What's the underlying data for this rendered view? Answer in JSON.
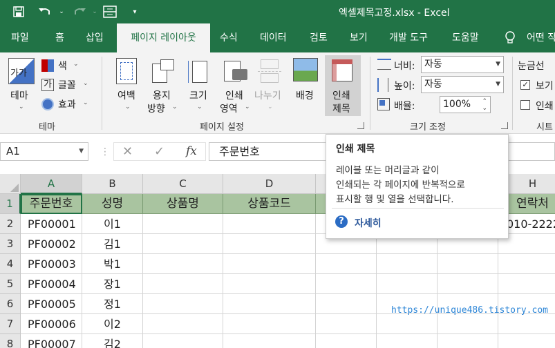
{
  "window": {
    "title": "엑셀제목고정.xlsx  -  Excel",
    "accent": "#217346"
  },
  "qat": {
    "save_icon": "save-icon",
    "undo_icon": "undo-icon",
    "redo_icon": "redo-icon",
    "customize_icon": "customize-icon"
  },
  "tabs": [
    {
      "label": "파일"
    },
    {
      "label": "홈"
    },
    {
      "label": "삽입"
    },
    {
      "label": "페이지 레이아웃",
      "active": true
    },
    {
      "label": "수식"
    },
    {
      "label": "데이터"
    },
    {
      "label": "검토"
    },
    {
      "label": "보기"
    },
    {
      "label": "개발 도구"
    },
    {
      "label": "도움말"
    },
    {
      "label": "어떤 작"
    }
  ],
  "ribbon": {
    "theme": {
      "theme_label": "테마",
      "colors_label": "색",
      "fonts_label": "글꼴",
      "effects_label": "효과",
      "group_label": "테마",
      "theme_icon_text": "가가"
    },
    "page_setup": {
      "margins_label": "여백",
      "orientation_label1": "용지",
      "orientation_label2": "방향",
      "size_label": "크기",
      "print_area_label1": "인쇄",
      "print_area_label2": "영역",
      "breaks_label": "나누기",
      "background_label": "배경",
      "print_titles_label1": "인쇄",
      "print_titles_label2": "제목",
      "group_label": "페이지 설정"
    },
    "scale": {
      "width_label": "너비:",
      "width_value": "자동",
      "height_label": "높이:",
      "height_value": "자동",
      "scale_label": "배율:",
      "scale_value": "100%",
      "group_label": "크기 조정"
    },
    "sheet_options": {
      "gridlines_label": "눈금선",
      "view_label": "보기",
      "print_label": "인쇄",
      "group_label": "시트"
    }
  },
  "formula_bar": {
    "name_box": "A1",
    "content": "주문번호",
    "fx": "fx"
  },
  "grid": {
    "columns": [
      "A",
      "B",
      "C",
      "D",
      "E",
      "F",
      "G",
      "H"
    ],
    "rows": [
      "1",
      "2",
      "3",
      "4",
      "5",
      "6",
      "7",
      "8"
    ],
    "header_row": [
      "주문번호",
      "성명",
      "상품명",
      "상품코드",
      "",
      "",
      "",
      "연락처"
    ],
    "data": [
      [
        "PF00001",
        "이1",
        "",
        "",
        "",
        "",
        "",
        "010-2222-"
      ],
      [
        "PF00002",
        "김1",
        "",
        "",
        "",
        "",
        "",
        ""
      ],
      [
        "PF00003",
        "박1",
        "",
        "",
        "",
        "",
        "",
        ""
      ],
      [
        "PF00004",
        "장1",
        "",
        "",
        "",
        "",
        "",
        ""
      ],
      [
        "PF00005",
        "정1",
        "",
        "",
        "",
        "",
        "",
        ""
      ],
      [
        "PF00006",
        "이2",
        "",
        "",
        "",
        "",
        "",
        ""
      ],
      [
        "PF00007",
        "김2",
        "",
        "",
        "",
        "",
        "",
        ""
      ]
    ],
    "header_color": "#a9c4a0"
  },
  "tooltip": {
    "title": "인쇄 제목",
    "lines": [
      "레이블 또는 머리글과 같이",
      "인쇄되는 각 페이지에 반복적으로",
      "표시할 행 및 열을 선택합니다."
    ],
    "help_label": "자세히",
    "help_icon": "help-icon"
  },
  "watermark": "https://unique486.tistory.com"
}
